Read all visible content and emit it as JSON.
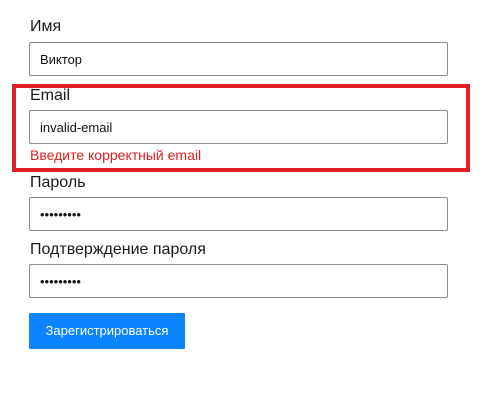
{
  "form": {
    "name": {
      "label": "Имя",
      "value": "Виктор"
    },
    "email": {
      "label": "Email",
      "value": "invalid-email",
      "error": "Введите корректный email"
    },
    "password": {
      "label": "Пароль",
      "value": "•••••••••"
    },
    "confirm_password": {
      "label": "Подтверждение пароля",
      "value": "•••••••••"
    },
    "submit_label": "Зарегистрироваться"
  },
  "colors": {
    "accent": "#0a84ff",
    "error": "#e0201e",
    "highlight": "#e3202a",
    "border": "#8c8c8c"
  }
}
